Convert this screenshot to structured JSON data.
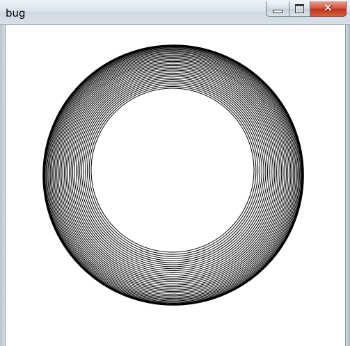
{
  "window": {
    "title": "bug",
    "controls": {
      "minimize_icon": "minimize-icon",
      "maximize_icon": "maximize-icon",
      "close_icon": "close-icon",
      "close_glyph": "✕"
    }
  },
  "drawing": {
    "ring_count": 34,
    "stroke_color": "#000000",
    "background_color": "#ffffff"
  },
  "colors": {
    "close_button": "#c13318",
    "titlebar": "#dbe4ec"
  }
}
